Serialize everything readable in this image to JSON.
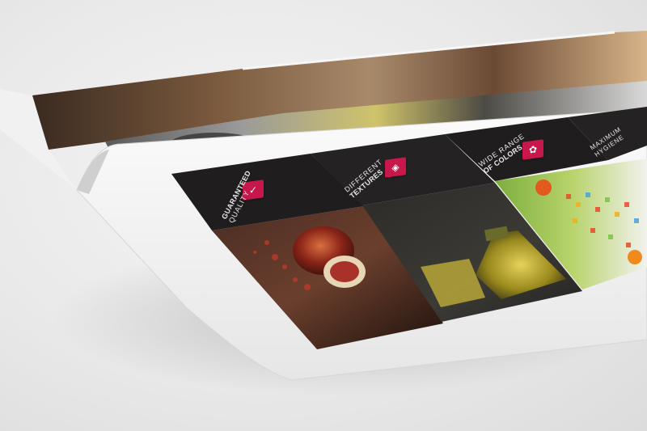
{
  "catalog": {
    "features": [
      {
        "title": "GUARANTEED",
        "subtitle": "QUALITY",
        "icon": "check-icon"
      },
      {
        "title": "DIFFERENT",
        "subtitle": "TEXTURES",
        "icon": "texture-icon"
      },
      {
        "title": "WIDE RANGE",
        "subtitle": "OF COLORS",
        "icon": "palette-icon"
      },
      {
        "title": "MAXIMUM",
        "subtitle": "HYGIENE",
        "icon": "hygiene-icon"
      }
    ]
  },
  "colors": {
    "accent": "#c8174a",
    "header_bg": "#1f1d1e",
    "paper": "#ffffff"
  }
}
